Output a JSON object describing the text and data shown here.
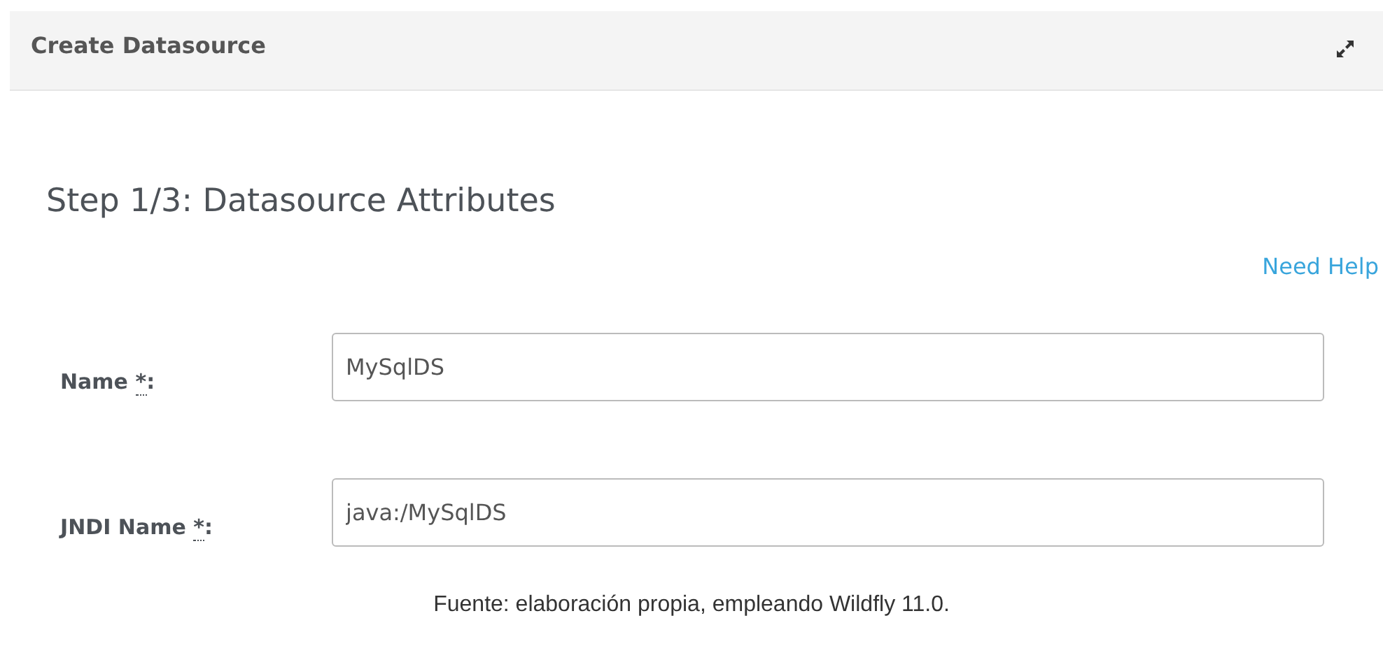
{
  "dialog": {
    "title": "Create Datasource"
  },
  "step_title": "Step 1/3: Datasource Attributes",
  "help_link": "Need Help",
  "fields": [
    {
      "label": "Name",
      "required_mark": "*",
      "label_end": ":",
      "value": "MySqlDS"
    },
    {
      "label": "JNDI Name",
      "required_mark": "*",
      "label_end": ":",
      "value": "java:/MySqlDS"
    }
  ],
  "caption": "Fuente: elaboración propia, empleando Wildfly 11.0."
}
